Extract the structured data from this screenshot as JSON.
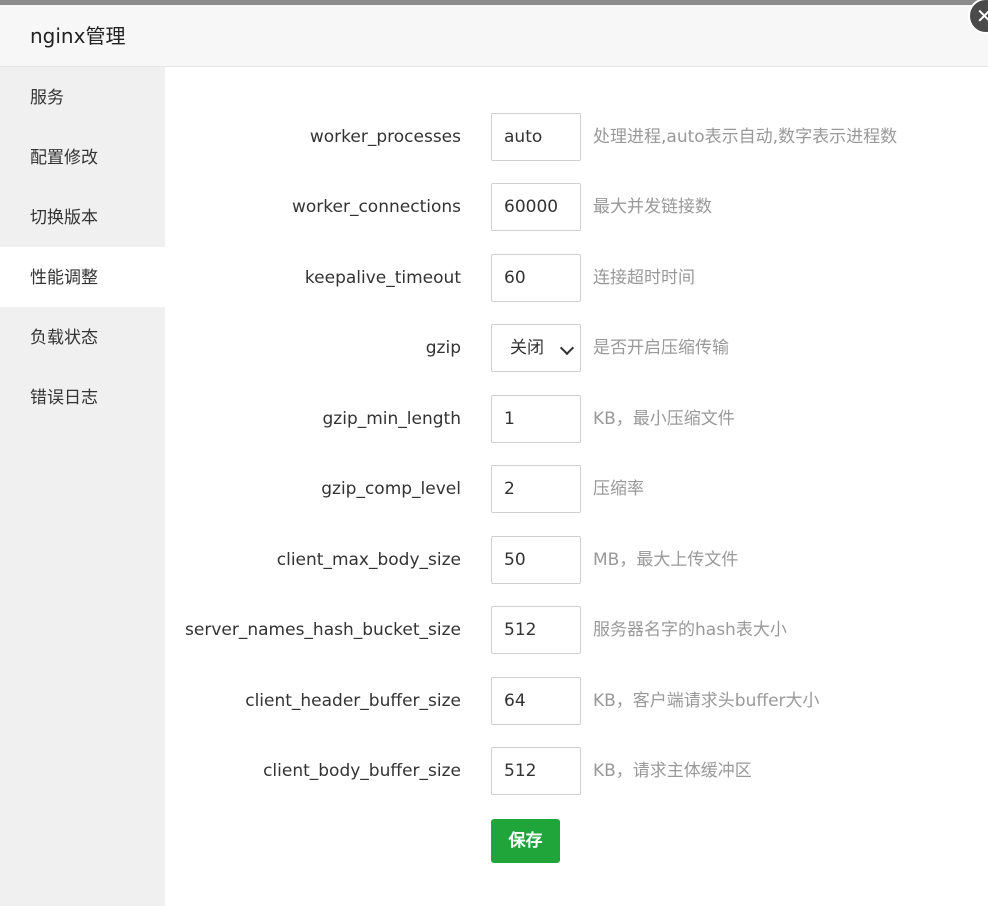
{
  "window": {
    "title": "nginx管理",
    "close_icon": "close-icon"
  },
  "sidebar": {
    "items": [
      {
        "label": "服务"
      },
      {
        "label": "配置修改"
      },
      {
        "label": "切换版本"
      },
      {
        "label": "性能调整",
        "active": true
      },
      {
        "label": "负载状态"
      },
      {
        "label": "错误日志"
      }
    ]
  },
  "form": {
    "rows": [
      {
        "label": "worker_processes",
        "value": "auto",
        "hint": "处理进程,auto表示自动,数字表示进程数"
      },
      {
        "label": "worker_connections",
        "value": "60000",
        "hint": "最大并发链接数"
      },
      {
        "label": "keepalive_timeout",
        "value": "60",
        "hint": "连接超时时间"
      },
      {
        "label": "gzip",
        "value": "关闭",
        "hint": "是否开启压缩传输"
      },
      {
        "label": "gzip_min_length",
        "value": "1",
        "hint": "KB，最小压缩文件"
      },
      {
        "label": "gzip_comp_level",
        "value": "2",
        "hint": "压缩率"
      },
      {
        "label": "client_max_body_size",
        "value": "50",
        "hint": "MB，最大上传文件"
      },
      {
        "label": "server_names_hash_bucket_size",
        "value": "512",
        "hint": "服务器名字的hash表大小"
      },
      {
        "label": "client_header_buffer_size",
        "value": "64",
        "hint": "KB，客户端请求头buffer大小"
      },
      {
        "label": "client_body_buffer_size",
        "value": "512",
        "hint": "KB，请求主体缓冲区"
      }
    ],
    "save_label": "保存"
  },
  "colors": {
    "accent": "#20a53a",
    "sidebar_bg": "#f0f0f0",
    "hint": "#999999"
  }
}
